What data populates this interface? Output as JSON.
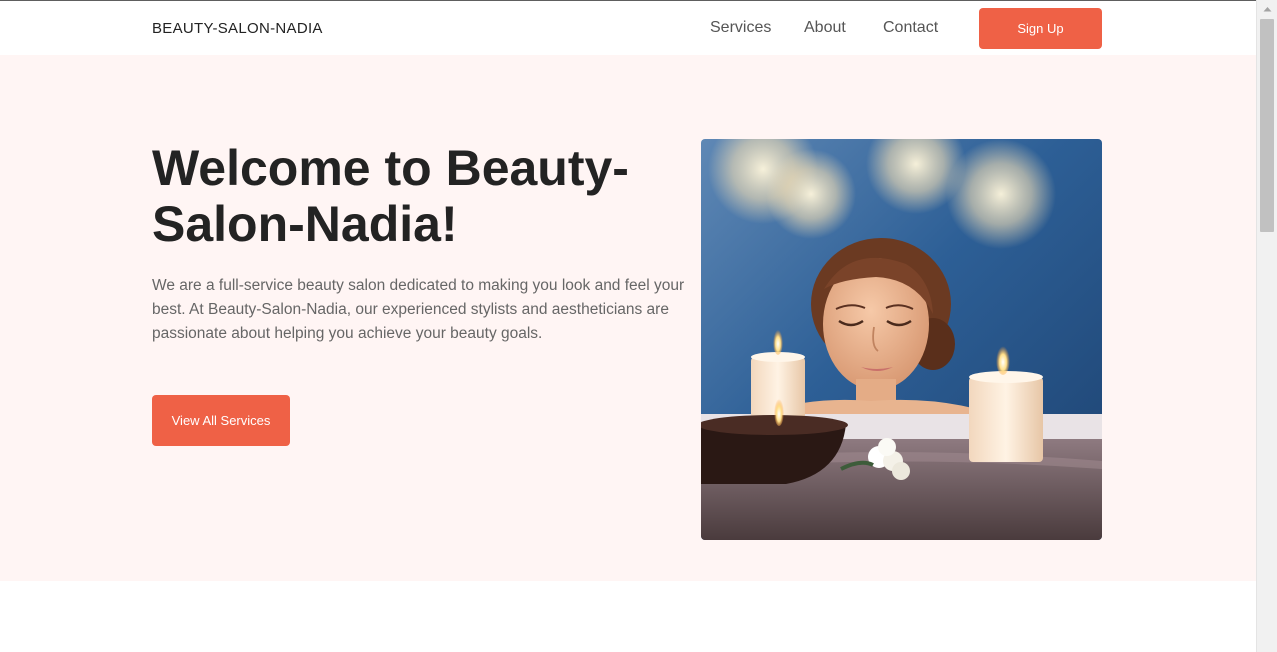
{
  "header": {
    "brand": "BEAUTY-SALON-NADIA",
    "nav": {
      "services": "Services",
      "about": "About",
      "contact": "Contact"
    },
    "signup_label": "Sign Up"
  },
  "hero": {
    "title": "Welcome to Beauty-Salon-Nadia!",
    "description": "We are a full-service beauty salon dedicated to making you look and feel your best. At Beauty-Salon-Nadia, our experienced stylists and aestheticians are passionate about helping you achieve your beauty goals.",
    "cta_label": "View All Services",
    "image_subject": "spa-woman-with-candles"
  },
  "colors": {
    "accent": "#ef6146",
    "hero_background": "#fff5f4",
    "heading": "#232323",
    "body_text": "#666666"
  },
  "scrollbar": {
    "icon": "chevron-up-icon"
  }
}
